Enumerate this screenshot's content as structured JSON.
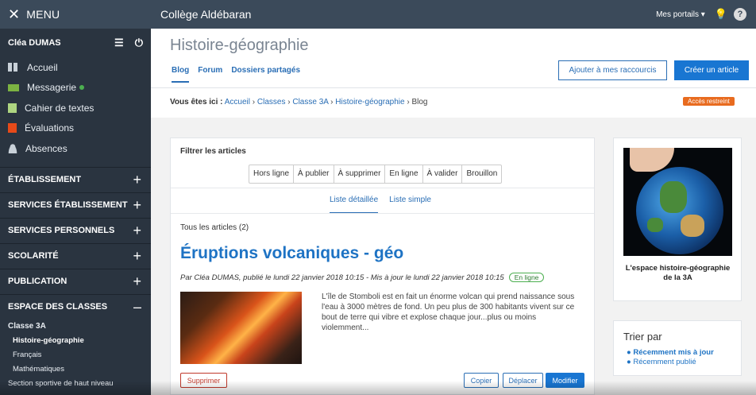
{
  "sidebar": {
    "menu_label": "MENU",
    "user_name": "Cléa DUMAS",
    "items": [
      {
        "label": "Accueil"
      },
      {
        "label": "Messagerie"
      },
      {
        "label": "Cahier de textes"
      },
      {
        "label": "Évaluations"
      },
      {
        "label": "Absences"
      }
    ],
    "sections": [
      {
        "label": "ÉTABLISSEMENT",
        "toggle": "+"
      },
      {
        "label": "SERVICES ÉTABLISSEMENT",
        "toggle": "+"
      },
      {
        "label": "SERVICES PERSONNELS",
        "toggle": "+"
      },
      {
        "label": "SCOLARITÉ",
        "toggle": "+"
      },
      {
        "label": "PUBLICATION",
        "toggle": "+"
      },
      {
        "label": "ESPACE DES CLASSES",
        "toggle": "–"
      }
    ],
    "class_name": "Classe 3A",
    "class_links": [
      {
        "label": "Histoire-géographie"
      },
      {
        "label": "Français"
      },
      {
        "label": "Mathématiques"
      },
      {
        "label": "Section sportive de haut niveau"
      }
    ]
  },
  "topbar": {
    "site_name": "Collège Aldébaran",
    "portals": "Mes portails",
    "help": "?"
  },
  "page": {
    "title": "Histoire-géographie",
    "tabs": [
      {
        "label": "Blog"
      },
      {
        "label": "Forum"
      },
      {
        "label": "Dossiers partagés"
      }
    ],
    "shortcut_button": "Ajouter à mes raccourcis",
    "create_button": "Créer un article",
    "breadcrumb": {
      "prefix": "Vous êtes ici :",
      "links": [
        "Accueil",
        "Classes",
        "Classe 3A",
        "Histoire-géographie"
      ],
      "current": "Blog"
    },
    "access_badge": "Accès restreint"
  },
  "main": {
    "filter_title": "Filtrer les articles",
    "filters": [
      "Hors ligne",
      "À publier",
      "À supprimer",
      "En ligne",
      "À valider",
      "Brouillon"
    ],
    "views": [
      "Liste détaillée",
      "Liste simple"
    ],
    "count_text": "Tous les articles (2)",
    "article": {
      "title": "Éruptions volcaniques - géo",
      "meta": "Par Cléa DUMAS, publié le lundi 22 janvier 2018 10:15 - Mis à jour le lundi 22 janvier 2018 10:15",
      "status": "En ligne",
      "excerpt": "L'île de Stomboli est en fait un énorme volcan qui prend naissance sous l'eau à 3000 mètres de fond. Un peu plus de 300 habitants vivent sur ce bout de terre qui vibre et explose chaque jour...plus ou moins violemment...",
      "delete_button": "Supprimer",
      "copy_button": "Copier",
      "move_button": "Déplacer",
      "edit_button": "Modifier"
    }
  },
  "aside": {
    "caption": "L'espace histoire-géographie de la 3A",
    "sort_title": "Trier par",
    "sort_options": [
      "Récemment mis à jour",
      "Récemment publié"
    ]
  }
}
